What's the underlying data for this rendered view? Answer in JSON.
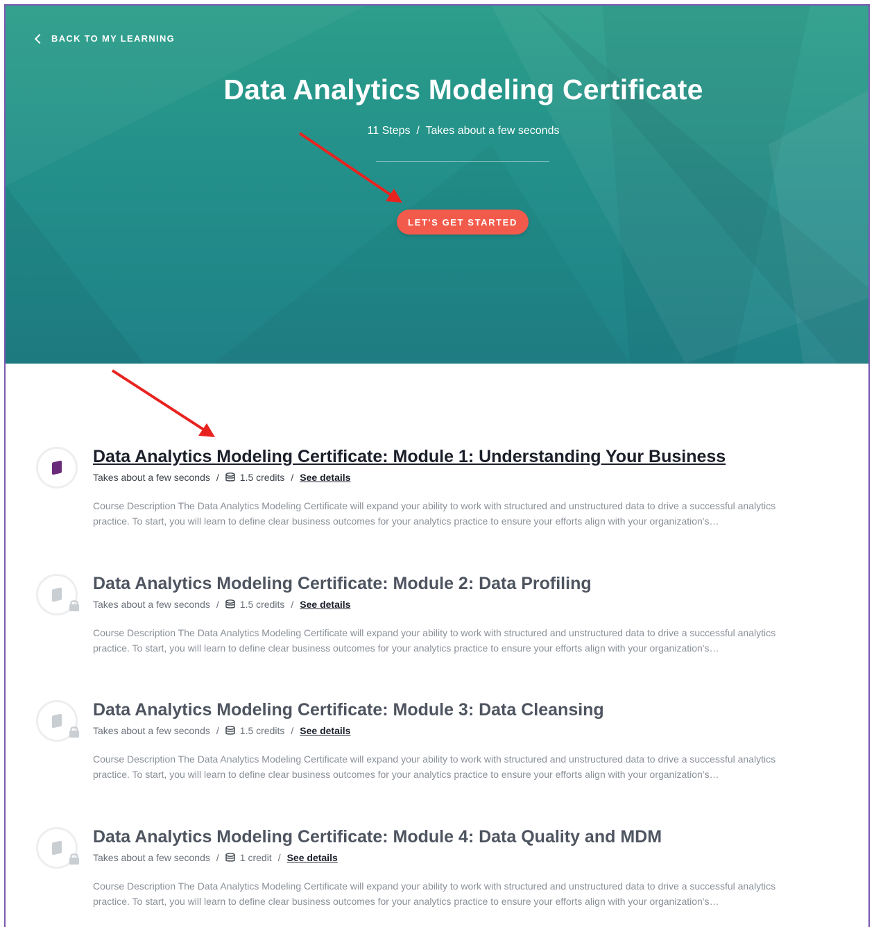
{
  "hero": {
    "back_label": "BACK TO MY LEARNING",
    "title": "Data Analytics Modeling Certificate",
    "steps": "11 Steps",
    "duration": "Takes about a few seconds",
    "cta_label": "LET'S GET STARTED"
  },
  "modules": [
    {
      "title": "Data Analytics Modeling Certificate: Module 1: Understanding Your Business",
      "duration": "Takes about a few seconds",
      "credits": "1.5 credits",
      "details_label": "See details",
      "description": "Course Description The Data Analytics Modeling Certificate will expand your ability to work with structured and unstructured data to drive a successful analytics practice. To start, you will learn to define clear business outcomes for your analytics practice to ensure your efforts align with your organization's…",
      "locked": false
    },
    {
      "title": "Data Analytics Modeling Certificate: Module 2: Data Profiling",
      "duration": "Takes about a few seconds",
      "credits": "1.5 credits",
      "details_label": "See details",
      "description": "Course Description The Data Analytics Modeling Certificate will expand your ability to work with structured and unstructured data to drive a successful analytics practice. To start, you will learn to define clear business outcomes for your analytics practice to ensure your efforts align with your organization's…",
      "locked": true
    },
    {
      "title": "Data Analytics Modeling Certificate: Module 3: Data Cleansing",
      "duration": "Takes about a few seconds",
      "credits": "1.5 credits",
      "details_label": "See details",
      "description": "Course Description The Data Analytics Modeling Certificate will expand your ability to work with structured and unstructured data to drive a successful analytics practice. To start, you will learn to define clear business outcomes for your analytics practice to ensure your efforts align with your organization's…",
      "locked": true
    },
    {
      "title": "Data Analytics Modeling Certificate: Module 4: Data Quality and MDM",
      "duration": "Takes about a few seconds",
      "credits": "1 credit",
      "details_label": "See details",
      "description": "Course Description The Data Analytics Modeling Certificate will expand your ability to work with structured and unstructured data to drive a successful analytics practice. To start, you will learn to define clear business outcomes for your analytics practice to ensure your efforts align with your organization's…",
      "locked": true
    }
  ],
  "colors": {
    "hero_teal": "#23908a",
    "cta_coral": "#f25b4b",
    "arrow_red": "#e8231f",
    "active_book": "#6a2c7a"
  }
}
